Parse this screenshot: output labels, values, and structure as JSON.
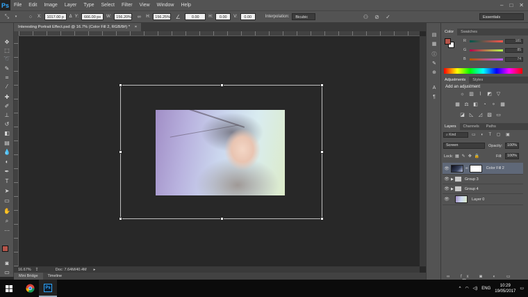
{
  "app": {
    "logo": "Ps",
    "menu": [
      "File",
      "Edit",
      "Image",
      "Layer",
      "Type",
      "Select",
      "Filter",
      "View",
      "Window",
      "Help"
    ],
    "window_controls": [
      "–",
      "□",
      "✕"
    ]
  },
  "options_bar": {
    "x_label": "X:",
    "x_value": "1017.00 p",
    "delta_icon": "Δ",
    "y_label": "Y:",
    "y_value": "666.00 px",
    "w_label": "W:",
    "w_value": "156.20%",
    "h_label": "H:",
    "h_value": "156.25%",
    "angle_value": "0.00",
    "hskew_label": "H:",
    "hskew_value": "0.00",
    "vskew_label": "V:",
    "vskew_value": "0.00",
    "interpolation_label": "Interpolation:",
    "interpolation_value": "Bicubic",
    "workspace": "Essentials"
  },
  "document": {
    "tab_title": "Interesting Portrait Effect.psd @ 16.7% (Color Fill 2, RGB/8#) *",
    "tab_close": "×"
  },
  "status_bar": {
    "zoom": "16.67%",
    "doc_info": "Doc: 7.64M/40.4M"
  },
  "bottom_tabs": [
    "Mini Bridge",
    "Timeline"
  ],
  "color_panel": {
    "tabs": [
      "Color",
      "Swatches"
    ],
    "foreground": "#b5554a",
    "background": "#ffffff",
    "channels": [
      {
        "label": "R",
        "value": "181"
      },
      {
        "label": "G",
        "value": "85"
      },
      {
        "label": "B",
        "value": "74"
      }
    ]
  },
  "adjustments_panel": {
    "tabs": [
      "Adjustments",
      "Styles"
    ],
    "heading": "Add an adjustment"
  },
  "layers_panel": {
    "tabs": [
      "Layers",
      "Channels",
      "Paths"
    ],
    "filter_kind": "Kind",
    "blend_mode": "Screen",
    "opacity_label": "Opacity:",
    "opacity_value": "100%",
    "lock_label": "Lock:",
    "fill_label": "Fill:",
    "fill_value": "100%",
    "layers": [
      {
        "name": "Color Fill 2",
        "kind": "fill",
        "selected": true
      },
      {
        "name": "Group 3",
        "kind": "group",
        "selected": false
      },
      {
        "name": "Group 4",
        "kind": "group",
        "selected": false
      },
      {
        "name": "Layer 0",
        "kind": "pixel",
        "selected": false
      }
    ]
  },
  "taskbar": {
    "language": "ENG",
    "time": "10:29",
    "date": "19/05/2017",
    "apps": [
      "chrome-icon",
      "photoshop-icon"
    ]
  }
}
